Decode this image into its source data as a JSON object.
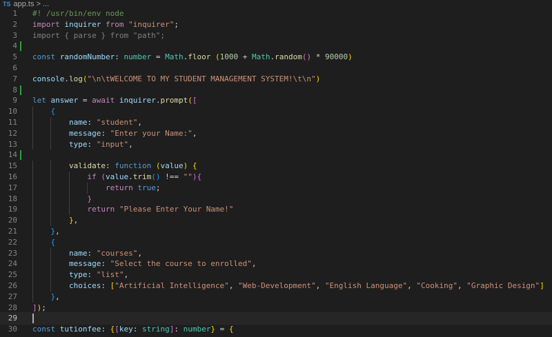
{
  "breadcrumb": {
    "badge": "TS",
    "file": "app.ts",
    "separator": "> ..."
  },
  "colors": {
    "background": "#1e1e1e",
    "default": "#d4d4d4",
    "comment": "#6a9955",
    "keyword": "#c586c0",
    "storage": "#569cd6",
    "variable": "#9cdcfe",
    "function": "#dcdcaa",
    "string": "#ce9178",
    "number": "#b5cea8",
    "type": "#4ec9b0",
    "bracket1": "#ffd700",
    "bracket2": "#da70d6",
    "bracket3": "#179fff",
    "unused": "#80807f"
  },
  "editor": {
    "lines": [
      {
        "n": "1",
        "tokens": [
          [
            "comment",
            "#! /usr/bin/env node"
          ]
        ]
      },
      {
        "n": "2",
        "tokens": [
          [
            "keyword",
            "import"
          ],
          [
            "default",
            " "
          ],
          [
            "variable",
            "inquirer"
          ],
          [
            "default",
            " "
          ],
          [
            "keyword",
            "from"
          ],
          [
            "default",
            " "
          ],
          [
            "string",
            "\"inquirer\""
          ],
          [
            "default",
            ";"
          ]
        ]
      },
      {
        "n": "3",
        "tokens": [
          [
            "unused",
            "import { parse } from \"path\";"
          ]
        ]
      },
      {
        "n": "4",
        "mark": true,
        "tokens": []
      },
      {
        "n": "5",
        "tokens": [
          [
            "storage",
            "const"
          ],
          [
            "default",
            " "
          ],
          [
            "variable",
            "randomNumber"
          ],
          [
            "default",
            ": "
          ],
          [
            "type",
            "number"
          ],
          [
            "default",
            " = "
          ],
          [
            "type",
            "Math"
          ],
          [
            "default",
            "."
          ],
          [
            "function",
            "floor"
          ],
          [
            "default",
            " "
          ],
          [
            "bracket1",
            "("
          ],
          [
            "number",
            "1000"
          ],
          [
            "default",
            " + "
          ],
          [
            "type",
            "Math"
          ],
          [
            "default",
            "."
          ],
          [
            "function",
            "random"
          ],
          [
            "bracket2",
            "()"
          ],
          [
            "default",
            " * "
          ],
          [
            "number",
            "90000"
          ],
          [
            "bracket1",
            ")"
          ]
        ]
      },
      {
        "n": "6",
        "tokens": []
      },
      {
        "n": "7",
        "tokens": [
          [
            "variable",
            "console"
          ],
          [
            "default",
            "."
          ],
          [
            "function",
            "log"
          ],
          [
            "bracket1",
            "("
          ],
          [
            "string",
            "\"\\n\\tWELCOME TO MY STUDENT MANAGEMENT SYSTEM!\\t\\n\""
          ],
          [
            "bracket1",
            ")"
          ]
        ]
      },
      {
        "n": "8",
        "mark": true,
        "tokens": []
      },
      {
        "n": "9",
        "tokens": [
          [
            "storage",
            "let"
          ],
          [
            "default",
            " "
          ],
          [
            "variable",
            "answer"
          ],
          [
            "default",
            " = "
          ],
          [
            "keyword",
            "await"
          ],
          [
            "default",
            " "
          ],
          [
            "variable",
            "inquirer"
          ],
          [
            "default",
            "."
          ],
          [
            "function",
            "prompt"
          ],
          [
            "bracket1",
            "("
          ],
          [
            "bracket2",
            "["
          ]
        ]
      },
      {
        "n": "10",
        "tokens": [
          [
            "default",
            "    "
          ],
          [
            "bracket3",
            "{"
          ]
        ]
      },
      {
        "n": "11",
        "tokens": [
          [
            "default",
            "        "
          ],
          [
            "variable",
            "name"
          ],
          [
            "default",
            ": "
          ],
          [
            "string",
            "\"student\""
          ],
          [
            "default",
            ","
          ]
        ]
      },
      {
        "n": "12",
        "tokens": [
          [
            "default",
            "        "
          ],
          [
            "variable",
            "message"
          ],
          [
            "default",
            ": "
          ],
          [
            "string",
            "\"Enter your Name:\""
          ],
          [
            "default",
            ","
          ]
        ]
      },
      {
        "n": "13",
        "tokens": [
          [
            "default",
            "        "
          ],
          [
            "variable",
            "type"
          ],
          [
            "default",
            ": "
          ],
          [
            "string",
            "\"input\""
          ],
          [
            "default",
            ","
          ]
        ]
      },
      {
        "n": "14",
        "mark": true,
        "tokens": []
      },
      {
        "n": "15",
        "tokens": [
          [
            "default",
            "        "
          ],
          [
            "function",
            "validate"
          ],
          [
            "default",
            ": "
          ],
          [
            "storage",
            "function"
          ],
          [
            "default",
            " "
          ],
          [
            "bracket1",
            "("
          ],
          [
            "variable",
            "value"
          ],
          [
            "bracket1",
            ")"
          ],
          [
            "default",
            " "
          ],
          [
            "bracket1",
            "{"
          ]
        ]
      },
      {
        "n": "16",
        "tokens": [
          [
            "default",
            "            "
          ],
          [
            "keyword",
            "if"
          ],
          [
            "default",
            " "
          ],
          [
            "bracket2",
            "("
          ],
          [
            "variable",
            "value"
          ],
          [
            "default",
            "."
          ],
          [
            "function",
            "trim"
          ],
          [
            "bracket3",
            "()"
          ],
          [
            "default",
            " !== "
          ],
          [
            "string",
            "\"\""
          ],
          [
            "bracket2",
            ")"
          ],
          [
            "bracket2",
            "{"
          ]
        ]
      },
      {
        "n": "17",
        "tokens": [
          [
            "default",
            "                "
          ],
          [
            "keyword",
            "return"
          ],
          [
            "default",
            " "
          ],
          [
            "storage",
            "true"
          ],
          [
            "default",
            ";"
          ]
        ]
      },
      {
        "n": "18",
        "tokens": [
          [
            "default",
            "            "
          ],
          [
            "bracket2",
            "}"
          ]
        ]
      },
      {
        "n": "19",
        "tokens": [
          [
            "default",
            "            "
          ],
          [
            "keyword",
            "return"
          ],
          [
            "default",
            " "
          ],
          [
            "string",
            "\"Please Enter Your Name!\""
          ]
        ]
      },
      {
        "n": "20",
        "tokens": [
          [
            "default",
            "        "
          ],
          [
            "bracket1",
            "}"
          ],
          [
            "default",
            ","
          ]
        ]
      },
      {
        "n": "21",
        "tokens": [
          [
            "default",
            "    "
          ],
          [
            "bracket3",
            "}"
          ],
          [
            "default",
            ","
          ]
        ]
      },
      {
        "n": "22",
        "tokens": [
          [
            "default",
            "    "
          ],
          [
            "bracket3",
            "{"
          ]
        ]
      },
      {
        "n": "23",
        "tokens": [
          [
            "default",
            "        "
          ],
          [
            "variable",
            "name"
          ],
          [
            "default",
            ": "
          ],
          [
            "string",
            "\"courses\""
          ],
          [
            "default",
            ","
          ]
        ]
      },
      {
        "n": "24",
        "tokens": [
          [
            "default",
            "        "
          ],
          [
            "variable",
            "message"
          ],
          [
            "default",
            ": "
          ],
          [
            "string",
            "\"Select the course to enrolled\""
          ],
          [
            "default",
            ","
          ]
        ]
      },
      {
        "n": "25",
        "tokens": [
          [
            "default",
            "        "
          ],
          [
            "variable",
            "type"
          ],
          [
            "default",
            ": "
          ],
          [
            "string",
            "\"list\""
          ],
          [
            "default",
            ","
          ]
        ]
      },
      {
        "n": "26",
        "tokens": [
          [
            "default",
            "        "
          ],
          [
            "variable",
            "choices"
          ],
          [
            "default",
            ": "
          ],
          [
            "bracket1",
            "["
          ],
          [
            "string",
            "\"Artificial Intelligence\""
          ],
          [
            "default",
            ", "
          ],
          [
            "string",
            "\"Web-Development\""
          ],
          [
            "default",
            ", "
          ],
          [
            "string",
            "\"English Language\""
          ],
          [
            "default",
            ", "
          ],
          [
            "string",
            "\"Cooking\""
          ],
          [
            "default",
            ", "
          ],
          [
            "string",
            "\"Graphic Design\""
          ],
          [
            "bracket1",
            "]"
          ]
        ]
      },
      {
        "n": "27",
        "tokens": [
          [
            "default",
            "    "
          ],
          [
            "bracket3",
            "}"
          ],
          [
            "default",
            ","
          ]
        ]
      },
      {
        "n": "28",
        "tokens": [
          [
            "bracket2",
            "]"
          ],
          [
            "bracket1",
            ")"
          ],
          [
            "default",
            ";"
          ]
        ]
      },
      {
        "n": "29",
        "active": true,
        "cursor": true,
        "tokens": []
      },
      {
        "n": "30",
        "tokens": [
          [
            "storage",
            "const"
          ],
          [
            "default",
            " "
          ],
          [
            "variable",
            "tutionfee"
          ],
          [
            "default",
            ": "
          ],
          [
            "bracket1",
            "{"
          ],
          [
            "bracket2",
            "["
          ],
          [
            "variable",
            "key"
          ],
          [
            "default",
            ": "
          ],
          [
            "type",
            "string"
          ],
          [
            "bracket2",
            "]"
          ],
          [
            "default",
            ": "
          ],
          [
            "type",
            "number"
          ],
          [
            "bracket1",
            "}"
          ],
          [
            "default",
            " = "
          ],
          [
            "bracket1",
            "{"
          ]
        ]
      }
    ]
  }
}
